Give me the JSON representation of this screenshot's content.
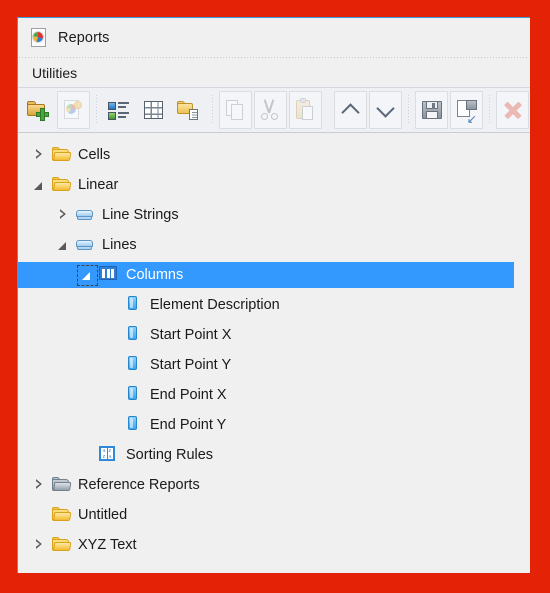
{
  "window": {
    "title": "Reports",
    "title_icon": "report-document-icon",
    "accent_border": "#3c9ade",
    "background": "#f0f0f0",
    "outer_background": "#e42306"
  },
  "ribbon": {
    "tabs": [
      {
        "label": "Utilities",
        "selected": true
      }
    ]
  },
  "toolbar": {
    "buttons": [
      {
        "name": "new-report-folder-button",
        "icon": "folder-plus-icon",
        "enabled": true,
        "framed": false
      },
      {
        "name": "new-report-button",
        "icon": "report-document-star-icon",
        "enabled": false,
        "framed": true
      },
      {
        "name": "sep-1",
        "icon": "separator",
        "enabled": false,
        "framed": false
      },
      {
        "name": "properties-list-button",
        "icon": "list-properties-icon",
        "enabled": true,
        "framed": false
      },
      {
        "name": "table-grid-button",
        "icon": "grid-table-icon",
        "enabled": true,
        "framed": false
      },
      {
        "name": "folder-document-button",
        "icon": "folder-document-icon",
        "enabled": true,
        "framed": false
      },
      {
        "name": "sep-2",
        "icon": "separator",
        "enabled": false,
        "framed": false
      },
      {
        "name": "copy-button",
        "icon": "copy-icon",
        "enabled": false,
        "framed": true
      },
      {
        "name": "cut-button",
        "icon": "scissors-icon",
        "enabled": false,
        "framed": true
      },
      {
        "name": "paste-button",
        "icon": "clipboard-paste-icon",
        "enabled": false,
        "framed": true
      },
      {
        "name": "sep-3",
        "icon": "separator",
        "enabled": false,
        "framed": false
      },
      {
        "name": "move-up-button",
        "icon": "chevron-up-icon",
        "enabled": true,
        "framed": true
      },
      {
        "name": "move-down-button",
        "icon": "chevron-down-icon",
        "enabled": true,
        "framed": true
      },
      {
        "name": "sep-4",
        "icon": "separator",
        "enabled": false,
        "framed": false
      },
      {
        "name": "save-button",
        "icon": "floppy-save-icon",
        "enabled": true,
        "framed": true
      },
      {
        "name": "save-as-button",
        "icon": "save-as-icon",
        "enabled": true,
        "framed": true
      },
      {
        "name": "sep-5",
        "icon": "separator",
        "enabled": false,
        "framed": false
      },
      {
        "name": "delete-button",
        "icon": "red-x-icon",
        "enabled": false,
        "framed": true
      }
    ]
  },
  "tree": {
    "selection_color": "#3399ff",
    "nodes": [
      {
        "label": "Cells",
        "indent": 0,
        "icon": "folder-yellow-icon",
        "expander": "collapsed",
        "selected": false,
        "focused": false
      },
      {
        "label": "Linear",
        "indent": 0,
        "icon": "folder-yellow-icon",
        "expander": "expanded",
        "selected": false,
        "focused": false
      },
      {
        "label": "Line Strings",
        "indent": 1,
        "icon": "layer-box-icon",
        "expander": "collapsed",
        "selected": false,
        "focused": false
      },
      {
        "label": "Lines",
        "indent": 1,
        "icon": "layer-box-icon",
        "expander": "expanded",
        "selected": false,
        "focused": false
      },
      {
        "label": "Columns",
        "indent": 2,
        "icon": "columns-icon",
        "expander": "expanded",
        "selected": true,
        "focused": true
      },
      {
        "label": "Element Description",
        "indent": 3,
        "icon": "column-field-icon",
        "expander": "none",
        "selected": false,
        "focused": false
      },
      {
        "label": "Start Point X",
        "indent": 3,
        "icon": "column-field-icon",
        "expander": "none",
        "selected": false,
        "focused": false
      },
      {
        "label": "Start Point Y",
        "indent": 3,
        "icon": "column-field-icon",
        "expander": "none",
        "selected": false,
        "focused": false
      },
      {
        "label": "End Point X",
        "indent": 3,
        "icon": "column-field-icon",
        "expander": "none",
        "selected": false,
        "focused": false
      },
      {
        "label": "End Point Y",
        "indent": 3,
        "icon": "column-field-icon",
        "expander": "none",
        "selected": false,
        "focused": false
      },
      {
        "label": "Sorting Rules",
        "indent": 2,
        "icon": "sorting-rules-icon",
        "expander": "none",
        "selected": false,
        "focused": false
      },
      {
        "label": "Reference Reports",
        "indent": 0,
        "icon": "folder-grey-icon",
        "expander": "collapsed",
        "selected": false,
        "focused": false
      },
      {
        "label": "Untitled",
        "indent": 0,
        "icon": "folder-yellow-icon",
        "expander": "none",
        "selected": false,
        "focused": false
      },
      {
        "label": "XYZ Text",
        "indent": 0,
        "icon": "folder-yellow-icon",
        "expander": "collapsed",
        "selected": false,
        "focused": false
      }
    ]
  },
  "sorting_icon_letters": [
    "A",
    "Z",
    "Z",
    "A"
  ]
}
